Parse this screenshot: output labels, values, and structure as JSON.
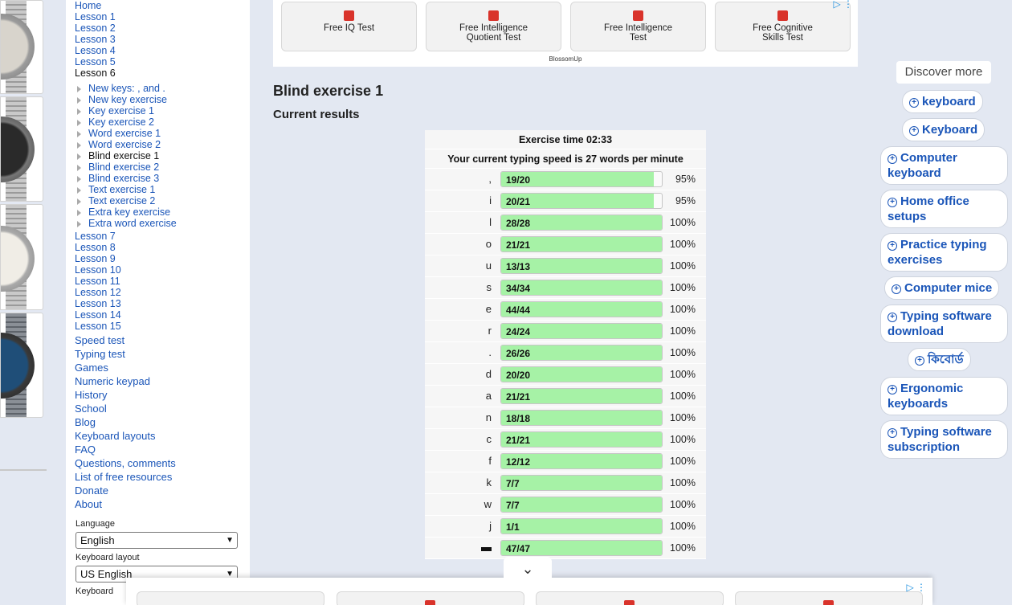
{
  "nav": {
    "top_links": [
      "Home",
      "Lesson 1",
      "Lesson 2",
      "Lesson 3",
      "Lesson 4",
      "Lesson 5",
      "Lesson 6"
    ],
    "sub_items": [
      "New keys: , and .",
      "New key exercise",
      "Key exercise 1",
      "Key exercise 2",
      "Word exercise 1",
      "Word exercise 2",
      "Blind exercise 1",
      "Blind exercise 2",
      "Blind exercise 3",
      "Text exercise 1",
      "Text exercise 2",
      "Extra key exercise",
      "Extra word exercise"
    ],
    "more_lessons": [
      "Lesson 7",
      "Lesson 8",
      "Lesson 9",
      "Lesson 10",
      "Lesson 11",
      "Lesson 12",
      "Lesson 13",
      "Lesson 14",
      "Lesson 15"
    ],
    "other_links": [
      "Speed test",
      "Typing test",
      "Games",
      "Numeric keypad",
      "History",
      "School",
      "Blog",
      "Keyboard layouts",
      "FAQ",
      "Questions, comments",
      "List of free resources",
      "Donate",
      "About"
    ],
    "language_label": "Language",
    "language_value": "English",
    "layout_label": "Keyboard layout",
    "layout_value": "US English",
    "keyboard_label": "Keyboard"
  },
  "top_ad": {
    "buttons": [
      "Free IQ Test",
      "Free Intelligence Quotient Test",
      "Free Intelligence Test",
      "Free Cognitive Skills Test"
    ],
    "footer": "BlossomUp"
  },
  "main": {
    "title": "Blind exercise 1",
    "results_title": "Current results",
    "exercise_time": "Exercise time 02:33",
    "speed_text": "Your current typing speed is 27 words per minute"
  },
  "results": [
    {
      "key": ",",
      "count": "19/20",
      "pct": "95%",
      "fill": 0.95
    },
    {
      "key": "i",
      "count": "20/21",
      "pct": "95%",
      "fill": 0.95
    },
    {
      "key": "l",
      "count": "28/28",
      "pct": "100%",
      "fill": 1
    },
    {
      "key": "o",
      "count": "21/21",
      "pct": "100%",
      "fill": 1
    },
    {
      "key": "u",
      "count": "13/13",
      "pct": "100%",
      "fill": 1
    },
    {
      "key": "s",
      "count": "34/34",
      "pct": "100%",
      "fill": 1
    },
    {
      "key": "e",
      "count": "44/44",
      "pct": "100%",
      "fill": 1
    },
    {
      "key": "r",
      "count": "24/24",
      "pct": "100%",
      "fill": 1
    },
    {
      "key": ".",
      "count": "26/26",
      "pct": "100%",
      "fill": 1
    },
    {
      "key": "d",
      "count": "20/20",
      "pct": "100%",
      "fill": 1
    },
    {
      "key": "a",
      "count": "21/21",
      "pct": "100%",
      "fill": 1
    },
    {
      "key": "n",
      "count": "18/18",
      "pct": "100%",
      "fill": 1
    },
    {
      "key": "c",
      "count": "21/21",
      "pct": "100%",
      "fill": 1
    },
    {
      "key": "f",
      "count": "12/12",
      "pct": "100%",
      "fill": 1
    },
    {
      "key": "k",
      "count": "7/7",
      "pct": "100%",
      "fill": 1
    },
    {
      "key": "w",
      "count": "7/7",
      "pct": "100%",
      "fill": 1
    },
    {
      "key": "j",
      "count": "1/1",
      "pct": "100%",
      "fill": 1
    },
    {
      "key": "",
      "count": "47/47",
      "pct": "100%",
      "fill": 1,
      "space": true
    }
  ],
  "discover": {
    "title": "Discover more",
    "chips": [
      "keyboard",
      "Keyboard",
      "Computer keyboard",
      "Home office setups",
      "Practice typing exercises",
      "Computer mice",
      "Typing software download",
      "কিবোর্ড",
      "Ergonomic keyboards",
      "Typing software subscription"
    ]
  },
  "colors": {
    "link": "#1a55b8",
    "bar_fill": "#a6f2a6",
    "background": "#e3e8f2"
  },
  "icons": [
    "adchoices-icon",
    "menu-dots-icon",
    "chevron-down-icon",
    "plus-circle-icon",
    "triangle-right-icon"
  ]
}
